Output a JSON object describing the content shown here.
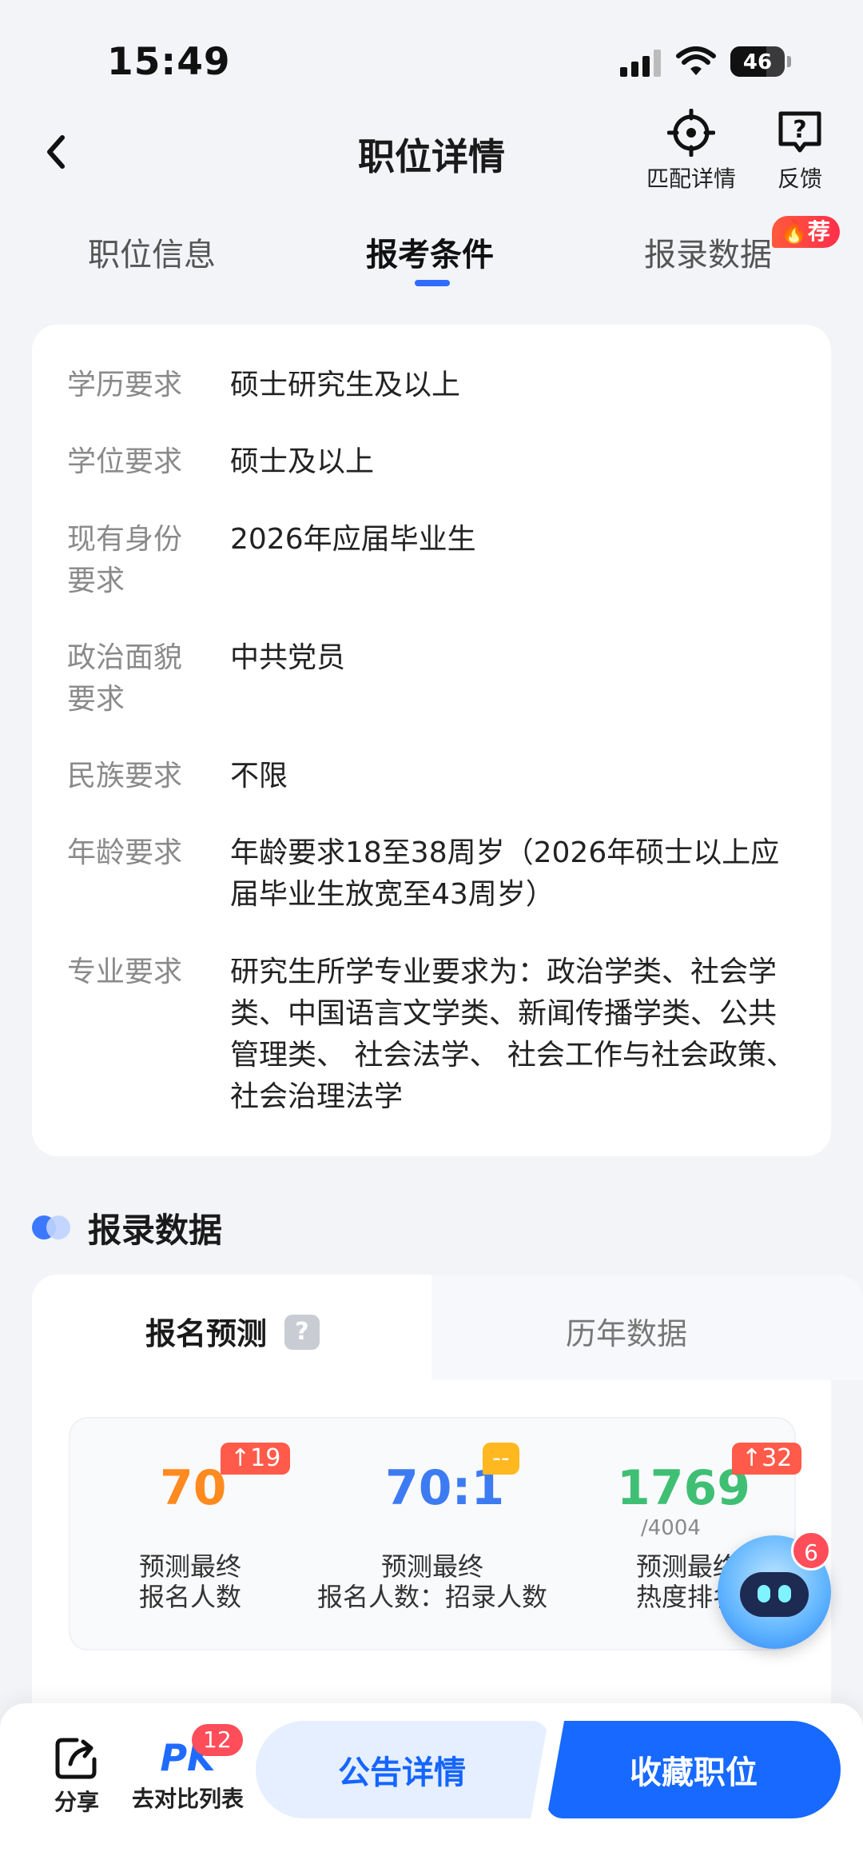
{
  "status_bar": {
    "time": "15:49",
    "battery": "46"
  },
  "header": {
    "title": "职位详情",
    "match_label": "匹配详情",
    "feedback_label": "反馈"
  },
  "tabs": [
    {
      "label": "职位信息",
      "active": false
    },
    {
      "label": "报考条件",
      "active": true
    },
    {
      "label": "报录数据",
      "active": false,
      "badge": "荐"
    }
  ],
  "requirements": [
    {
      "label": "学历要求",
      "value": "硕士研究生及以上"
    },
    {
      "label": "学位要求",
      "value": "硕士及以上"
    },
    {
      "label": "现有身份要求",
      "value": "2026年应届毕业生"
    },
    {
      "label": "政治面貌要求",
      "value": "中共党员"
    },
    {
      "label": "民族要求",
      "value": "不限"
    },
    {
      "label": "年龄要求",
      "value": "年龄要求18至38周岁（2026年硕士以上应届毕业生放宽至43周岁）"
    },
    {
      "label": "专业要求",
      "value": "研究生所学专业要求为：政治学类、社会学类、中国语言文学类、新闻传播学类、公共管理类、 社会法学、 社会工作与社会政策、 社会治理法学"
    }
  ],
  "data_section": {
    "title": "报录数据",
    "tab_active": "报名预测",
    "tab_inactive": "历年数据",
    "help": "?",
    "stats": [
      {
        "value": "70",
        "badge": "19",
        "caption": "预测最终\n报名人数",
        "color": "#ff8a1f"
      },
      {
        "value": "70:1",
        "badge": "--",
        "caption": "预测最终\n报名人数：招录人数",
        "color": "#3d7bf2"
      },
      {
        "value": "1769",
        "sub": "/4004",
        "badge": "32",
        "caption": "预测最终\n热度排名",
        "color": "#3fbf74"
      }
    ]
  },
  "assistant": {
    "badge": "6"
  },
  "bottom_bar": {
    "share_label": "分享",
    "compare_label": "去对比列表",
    "compare_badge": "12",
    "pk_text": "PK",
    "notice_button": "公告详情",
    "favorite_button": "收藏职位"
  },
  "colors": {
    "accent": "#1769ff",
    "hot": "#ff3b3b",
    "orange": "#ff8a1f",
    "blue": "#3d7bf2",
    "green": "#3fbf74"
  }
}
